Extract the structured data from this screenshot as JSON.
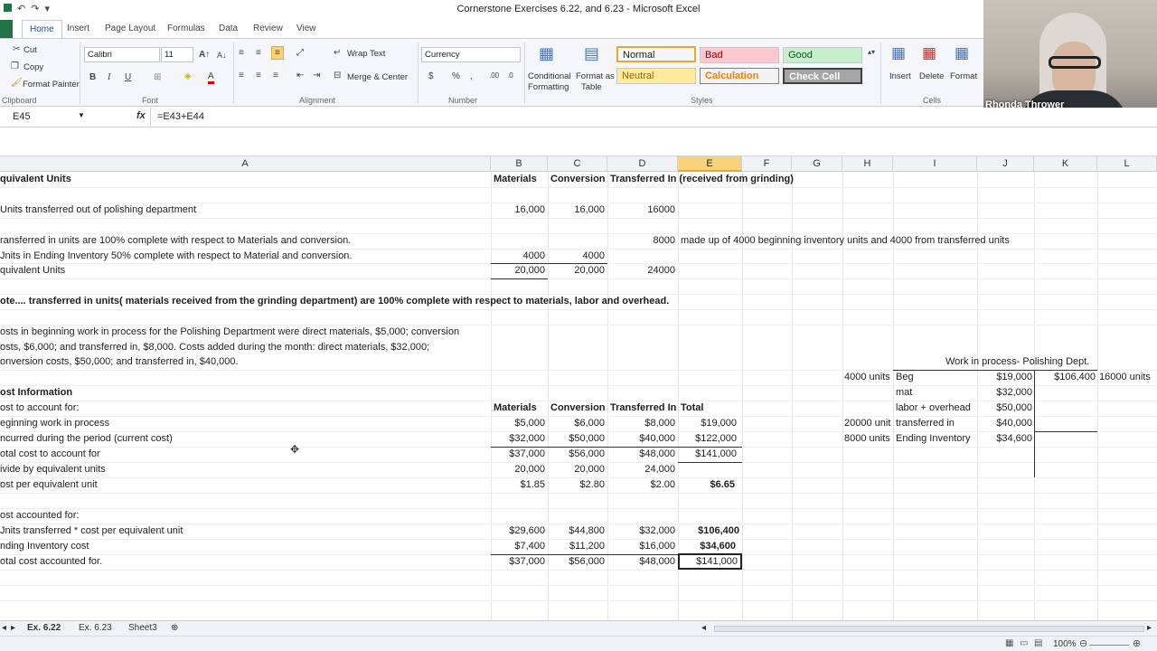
{
  "window": {
    "title": "Cornerstone Exercises 6.22, and 6.23 - Microsoft Excel"
  },
  "ribbon_tabs": [
    "Home",
    "Insert",
    "Page Layout",
    "Formulas",
    "Data",
    "Review",
    "View"
  ],
  "clipboard": {
    "cut": "Cut",
    "copy": "Copy",
    "format_painter": "Format Painter",
    "label": "Clipboard"
  },
  "font": {
    "name": "Calibri",
    "size": "11",
    "label": "Font"
  },
  "alignment": {
    "wrap": "Wrap Text",
    "merge": "Merge & Center",
    "label": "Alignment"
  },
  "number": {
    "format": "Currency",
    "label": "Number",
    "dollar": "$",
    "percent": "%"
  },
  "styles": {
    "cond_line1": "Conditional",
    "cond_line2": "Formatting",
    "table_line1": "Format as",
    "table_line2": "Table",
    "normal": "Normal",
    "bad": "Bad",
    "good": "Good",
    "neutral": "Neutral",
    "calculation": "Calculation",
    "check_cell": "Check Cell",
    "label": "Styles",
    "colors": {
      "normal_bg": "#ffffff",
      "bad_bg": "#ffc7ce",
      "bad_fg": "#9c0006",
      "good_bg": "#c6efce",
      "good_fg": "#006100",
      "neutral_bg": "#ffeb9c",
      "neutral_fg": "#9c6500",
      "calc_bg": "#f2f2f2",
      "calc_fg": "#fa7d00",
      "check_bg": "#a5a5a5"
    }
  },
  "cells_group": {
    "insert": "Insert",
    "delete": "Delete",
    "format": "Format",
    "label": "Cells"
  },
  "webcam": {
    "name": "Rhonda Thrower"
  },
  "formula_bar": {
    "name_box": "E45",
    "fx": "fx",
    "formula": "=E43+E44"
  },
  "columns": [
    "A",
    "B",
    "C",
    "D",
    "E",
    "F",
    "G",
    "H",
    "I",
    "J",
    "K",
    "L"
  ],
  "sheet": {
    "r1": {
      "a": "quivalent Units",
      "b": "Materials",
      "c": "Conversion",
      "d": "Transferred In (received from grinding)"
    },
    "r3": {
      "a": "Units  transferred out of polishing department",
      "b": "16,000",
      "c": "16,000",
      "d": "16000"
    },
    "r5": {
      "a": "ransferred in units are 100% complete with respect to Materials and conversion.",
      "d": "8000",
      "e": "made up of 4000 beginning inventory units and 4000 from transferred units"
    },
    "r6": {
      "a": "Jnits in Ending Inventory 50%  complete with respect to Material and conversion.",
      "b": "4000",
      "c": "4000"
    },
    "r7": {
      "a": "quivalent Units",
      "b": "20,000",
      "c": "20,000",
      "d": "24000"
    },
    "r9": {
      "a": "ote.... transferred in units( materials received from the grinding department)  are 100% complete with respect to materials, labor and overhead."
    },
    "r11": {
      "a": "osts in beginning work in process for the Polishing Department were direct materials, $5,000; conversion"
    },
    "r12": {
      "a": "osts, $6,000; and transferred in, $8,000. Costs added during the month: direct materials, $32,000;"
    },
    "r13": {
      "a": "onversion costs, $50,000; and transferred in, $40,000.",
      "i": "Work in process- Polishing Dept."
    },
    "r14": {
      "h": "4000 units",
      "i": "Beg",
      "j": "$19,000",
      "k": "$106,400",
      "l": "16000 units"
    },
    "r15": {
      "a": "ost Information",
      "i": "mat",
      "j": "$32,000"
    },
    "r16": {
      "a": "ost to account for:",
      "b": "Materials",
      "c": "Conversion",
      "d": "Transferred In",
      "e": "Total",
      "i": "labor + overhead",
      "j": "$50,000"
    },
    "r17": {
      "a": "eginning work in process",
      "b": "$5,000",
      "c": "$6,000",
      "d": "$8,000",
      "e": "$19,000",
      "h": "20000 unit",
      "i": "transferred in",
      "j": "$40,000"
    },
    "r18": {
      "a": "ncurred during the period (current cost)",
      "b": "$32,000",
      "c": "$50,000",
      "d": "$40,000",
      "e": "$122,000",
      "h": "8000 units",
      "i": "Ending Inventory",
      "j": "$34,600"
    },
    "r19": {
      "a": "otal cost to account for",
      "b": "$37,000",
      "c": "$56,000",
      "d": "$48,000",
      "e": "$141,000"
    },
    "r20": {
      "a": "ivide by equivalent units",
      "b": "20,000",
      "c": "20,000",
      "d": "24,000"
    },
    "r21": {
      "a": "ost per equivalent unit",
      "b": "$1.85",
      "c": "$2.80",
      "d": "$2.00",
      "e": "$6.65"
    },
    "r23": {
      "a": "ost accounted for:"
    },
    "r24": {
      "a": "Jnits transferred * cost per equivalent unit",
      "b": "$29,600",
      "c": "$44,800",
      "d": "$32,000",
      "e": "$106,400"
    },
    "r25": {
      "a": "nding Inventory cost",
      "b": "$7,400",
      "c": "$11,200",
      "d": "$16,000",
      "e": "$34,600"
    },
    "r26": {
      "a": "otal cost  accounted for.",
      "b": "$37,000",
      "c": "$56,000",
      "d": "$48,000",
      "e": "$141,000"
    }
  },
  "sheet_tabs": [
    "Ex. 6.22",
    "Ex. 6.23",
    "Sheet3"
  ],
  "status": {
    "zoom": "100%"
  }
}
